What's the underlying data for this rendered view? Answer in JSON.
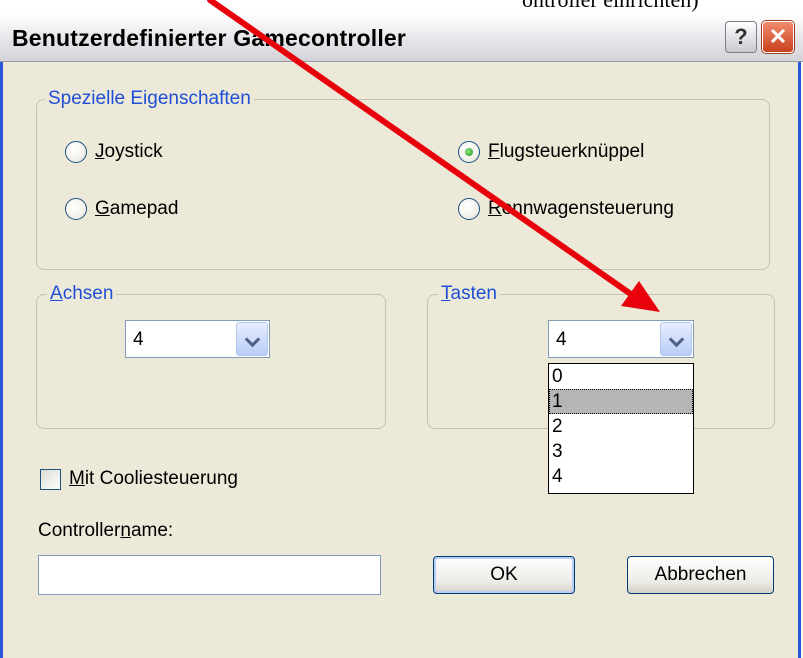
{
  "caption_fragment": "ontroller einrichten)",
  "window": {
    "title": "Benutzerdefinierter Gamecontroller",
    "help_glyph": "?",
    "close_glyph": "✕"
  },
  "properties_group": {
    "legend": "Spezielle Eigenschaften",
    "options": [
      {
        "mnemonic": "J",
        "rest": "oystick",
        "checked": false
      },
      {
        "mnemonic": "F",
        "rest": "lugsteuerknüppel",
        "checked": true
      },
      {
        "mnemonic": "G",
        "rest": "amepad",
        "checked": false
      },
      {
        "mnemonic": "R",
        "rest": "ennwagensteuerung",
        "checked": false
      }
    ]
  },
  "axes_group": {
    "legend_mnemonic": "A",
    "legend_rest": "chsen",
    "value": "4"
  },
  "buttons_group": {
    "legend_mnemonic": "T",
    "legend_rest": "asten",
    "value": "4",
    "options": [
      "0",
      "1",
      "2",
      "3",
      "4"
    ],
    "highlighted_option": "1"
  },
  "coolie": {
    "before": "M",
    "rest": "it Cooliesteuerung",
    "checked": false
  },
  "controller_name": {
    "label_before": "Controller",
    "label_mnemonic": "n",
    "label_after": "ame:",
    "value": ""
  },
  "actions": {
    "ok_label": "OK",
    "cancel_label": "Abbrechen"
  },
  "annotation": {
    "arrow_color": "#e8000b"
  }
}
